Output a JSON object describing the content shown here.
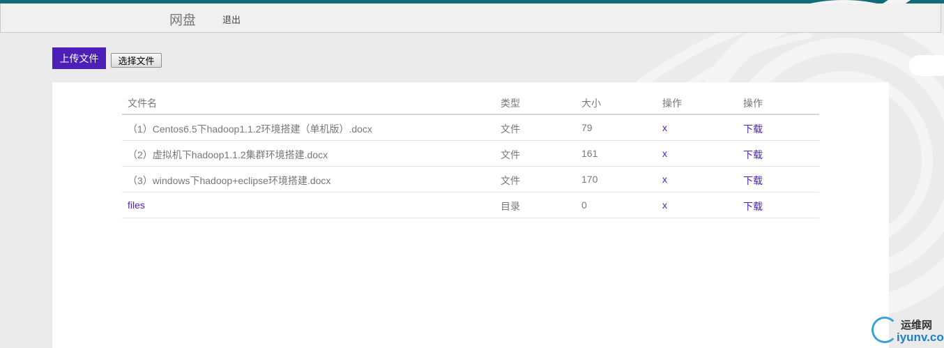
{
  "navbar": {
    "brand": "网盘",
    "logout": "退出"
  },
  "toolbar": {
    "upload_label": "上传文件",
    "choose_label": "选择文件"
  },
  "table": {
    "headers": [
      "文件名",
      "类型",
      "大小",
      "操作",
      "操作"
    ],
    "rows": [
      {
        "name": "（1）Centos6.5下hadoop1.1.2环境搭建（单机版）.docx",
        "type": "文件",
        "size": "79",
        "delete": "x",
        "download": "下载"
      },
      {
        "name": "（2）虚拟机下hadoop1.1.2集群环境搭建.docx",
        "type": "文件",
        "size": "161",
        "delete": "x",
        "download": "下载"
      },
      {
        "name": "（3）windows下hadoop+eclipse环境搭建.docx",
        "type": "文件",
        "size": "170",
        "delete": "x",
        "download": "下载"
      },
      {
        "name": "files",
        "type": "目录",
        "size": "0",
        "delete": "x",
        "download": "下载"
      }
    ]
  },
  "watermark": {
    "top": "运维网",
    "bottom": "iyunv.com"
  },
  "colors": {
    "accent": "#4b1fb8",
    "top_stripe": "#0f6b78"
  }
}
